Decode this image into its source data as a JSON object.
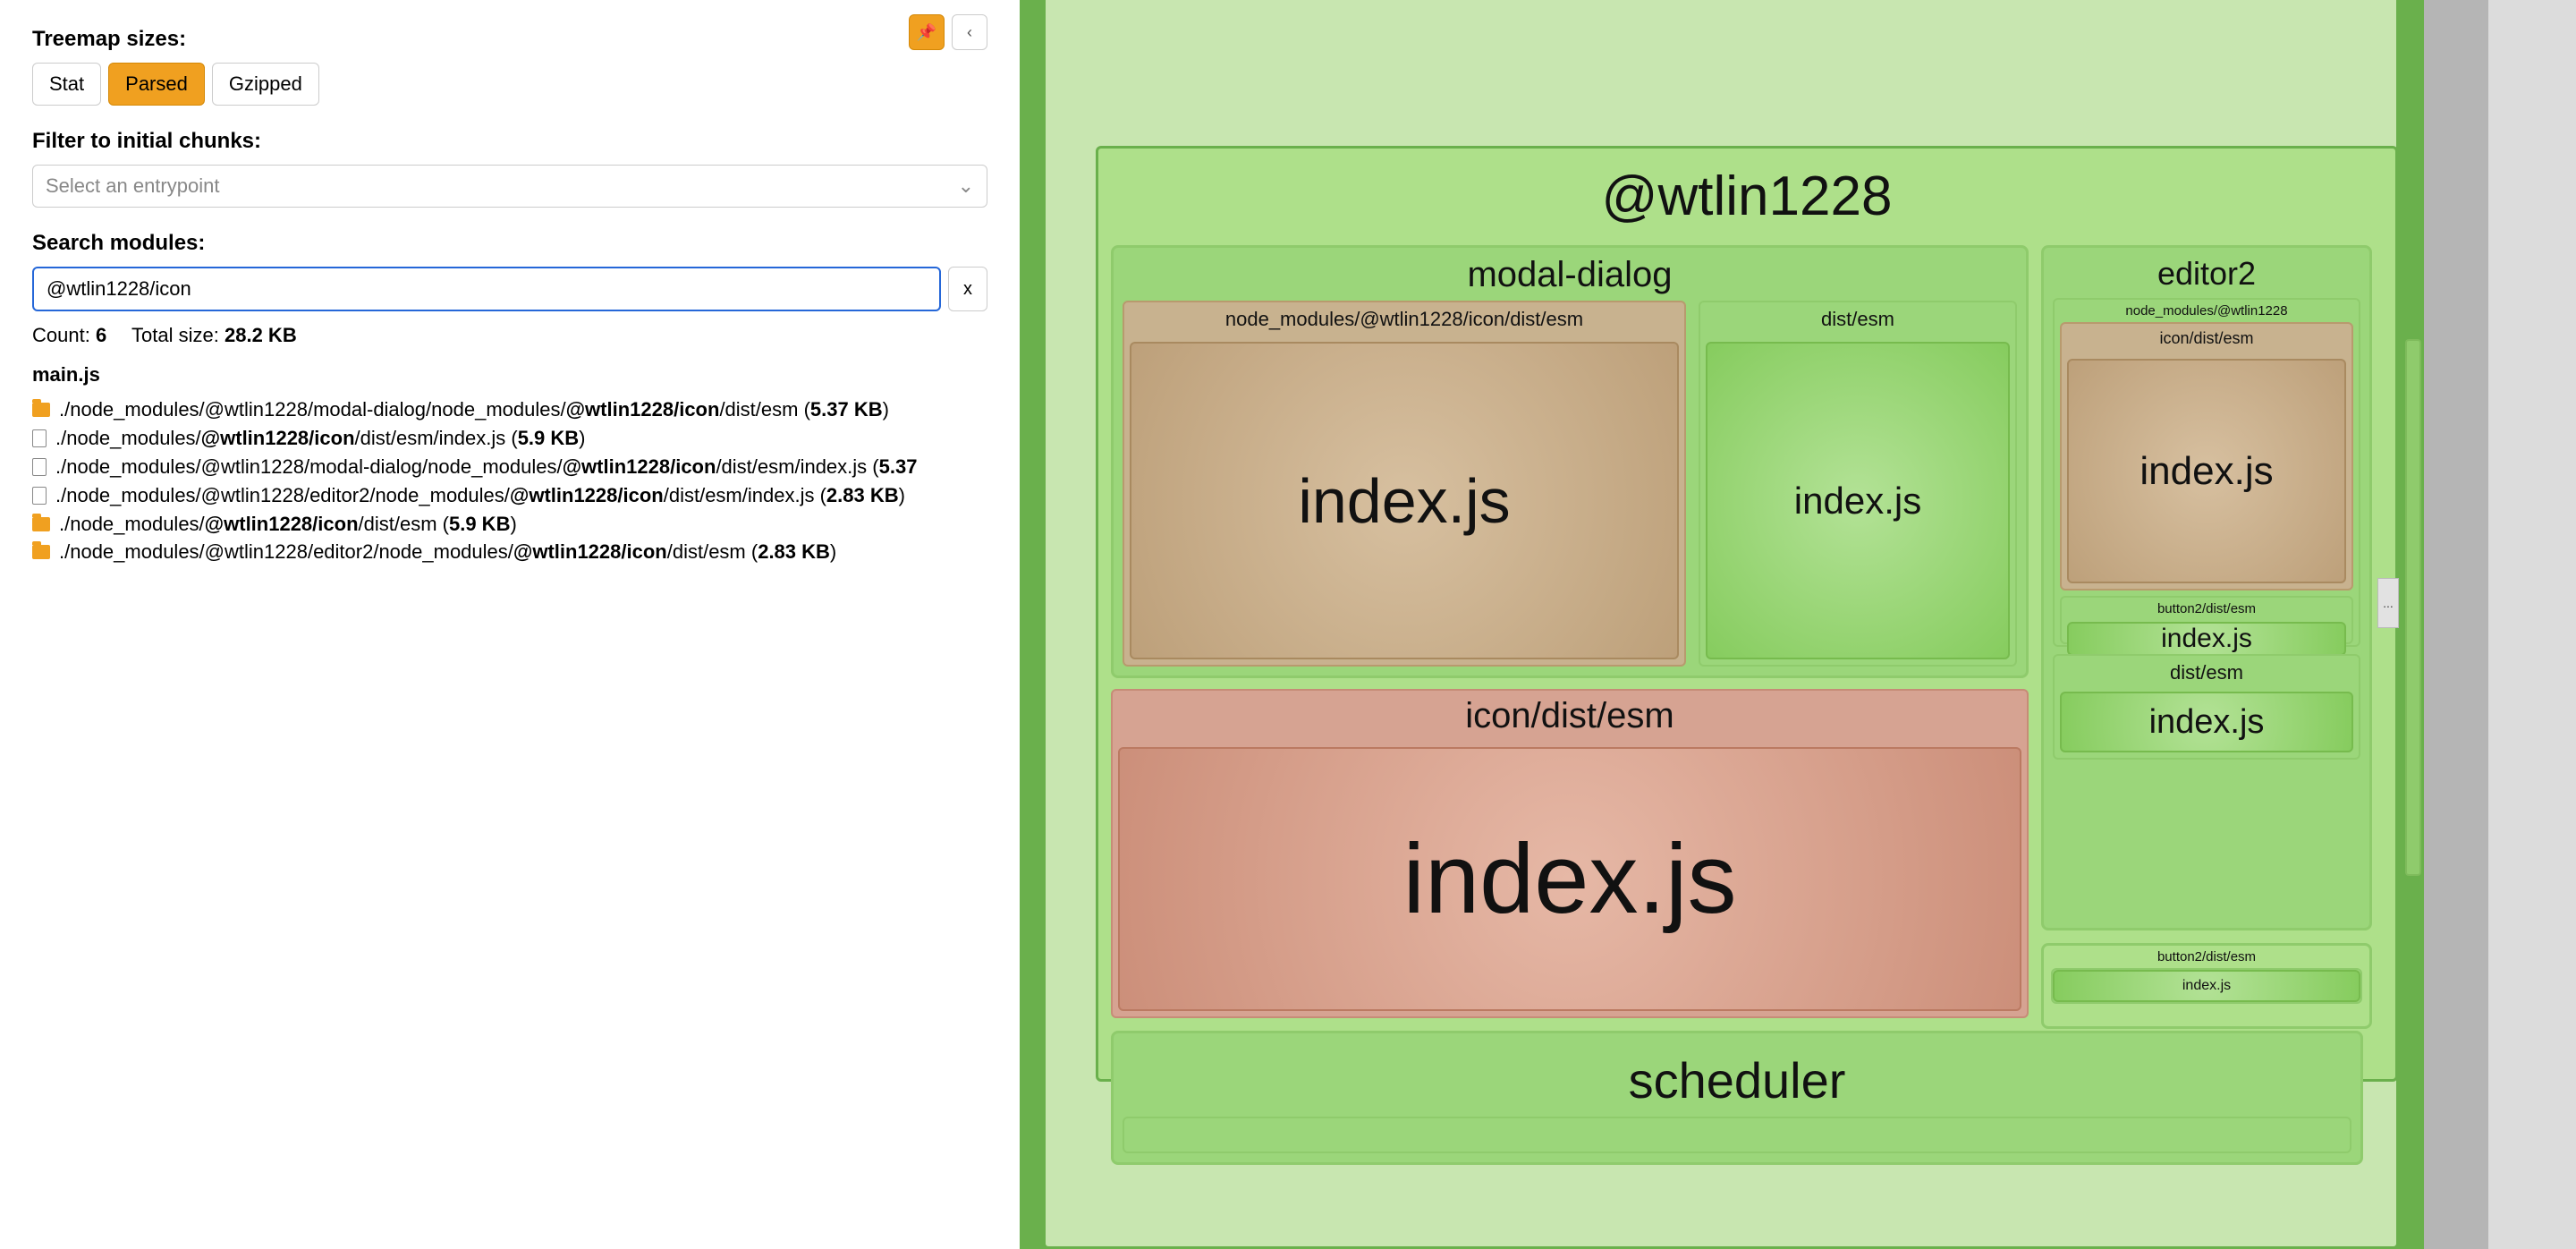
{
  "sidebar": {
    "pin_glyph": "📌",
    "collapse_glyph": "‹",
    "sizes_label": "Treemap sizes:",
    "size_buttons": {
      "stat": "Stat",
      "parsed": "Parsed",
      "gzipped": "Gzipped"
    },
    "filter_label": "Filter to initial chunks:",
    "entrypoint_placeholder": "Select an entrypoint",
    "chevron": "⌄",
    "search_label": "Search modules:",
    "search_value": "@wtlin1228/icon",
    "clear_label": "x",
    "count_label": "Count:",
    "count_value": "6",
    "totalsize_label": "Total size:",
    "totalsize_value": "28.2 KB",
    "chunk_name": "main.js",
    "modules": [
      {
        "type": "folder",
        "pre": "./node_modules/@wtlin1228/modal-dialog/node_modules/",
        "match": "@wtlin1228/icon",
        "post": "/dist/esm (",
        "size": "5.37 KB",
        "close": ")"
      },
      {
        "type": "file",
        "pre": "./node_modules/",
        "match": "@wtlin1228/icon",
        "post": "/dist/esm/index.js (",
        "size": "5.9 KB",
        "close": ")"
      },
      {
        "type": "file",
        "pre": "./node_modules/@wtlin1228/modal-dialog/node_modules/",
        "match": "@wtlin1228/icon",
        "post": "/dist/esm/index.js (",
        "size": "5.37",
        "close": ""
      },
      {
        "type": "file",
        "pre": "./node_modules/@wtlin1228/editor2/node_modules/",
        "match": "@wtlin1228/icon",
        "post": "/dist/esm/index.js (",
        "size": "2.83 KB",
        "close": ")"
      },
      {
        "type": "folder",
        "pre": "./node_modules/",
        "match": "@wtlin1228/icon",
        "post": "/dist/esm (",
        "size": "5.9 KB",
        "close": ")"
      },
      {
        "type": "folder",
        "pre": "./node_modules/@wtlin1228/editor2/node_modules/",
        "match": "@wtlin1228/icon",
        "post": "/dist/esm (",
        "size": "2.83 KB",
        "close": ")"
      }
    ]
  },
  "treemap": {
    "package_title": "@wtlin1228",
    "modal": {
      "title": "modal-dialog",
      "left_leaf_header": "node_modules/@wtlin1228/icon/dist/esm",
      "left_leaf_label": "index.js",
      "right_leaf_header": "dist/esm",
      "right_leaf_label": "index.js"
    },
    "editor2": {
      "title": "editor2",
      "nm_header": "node_modules/@wtlin1228",
      "icon_header": "icon/dist/esm",
      "icon_label": "index.js",
      "btn2_header": "button2/dist/esm",
      "btn2_label": "index.js",
      "dist_header": "dist/esm",
      "dist_label": "index.js"
    },
    "icon": {
      "header": "icon/dist/esm",
      "label": "index.js"
    },
    "scheduler": {
      "title": "scheduler"
    },
    "button2_small": {
      "header": "button2/dist/esm",
      "label": "index.js"
    },
    "ellipsis": "..."
  }
}
